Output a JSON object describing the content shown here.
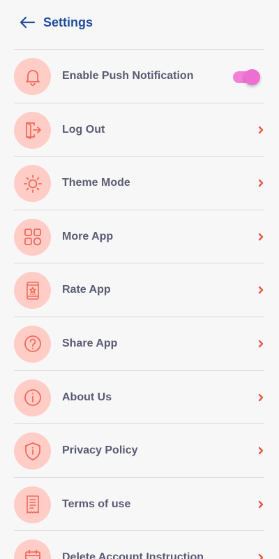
{
  "header": {
    "title": "Settings",
    "back_icon": "arrow-left-icon"
  },
  "colors": {
    "accent_title": "#1f4e9c",
    "icon_bg": "#ffcdc6",
    "icon_stroke": "#f06a5c",
    "toggle": "#ee6fd2",
    "label": "#5a5b72"
  },
  "settings": {
    "items": [
      {
        "label": "Enable Push Notification",
        "icon": "bell-icon",
        "control": "toggle",
        "enabled": true
      },
      {
        "label": "Log Out",
        "icon": "logout-icon",
        "control": "chevron"
      },
      {
        "label": "Theme Mode",
        "icon": "sun-icon",
        "control": "chevron"
      },
      {
        "label": "More App",
        "icon": "apps-grid-icon",
        "control": "chevron"
      },
      {
        "label": "Rate App",
        "icon": "rate-phone-icon",
        "control": "chevron"
      },
      {
        "label": "Share App",
        "icon": "question-circle-icon",
        "control": "chevron"
      },
      {
        "label": "About Us",
        "icon": "info-circle-icon",
        "control": "chevron"
      },
      {
        "label": "Privacy Policy",
        "icon": "shield-icon",
        "control": "chevron"
      },
      {
        "label": "Terms of use",
        "icon": "document-icon",
        "control": "chevron"
      },
      {
        "label": "Delete Account Instruction",
        "icon": "calendar-icon",
        "control": "chevron"
      }
    ]
  }
}
